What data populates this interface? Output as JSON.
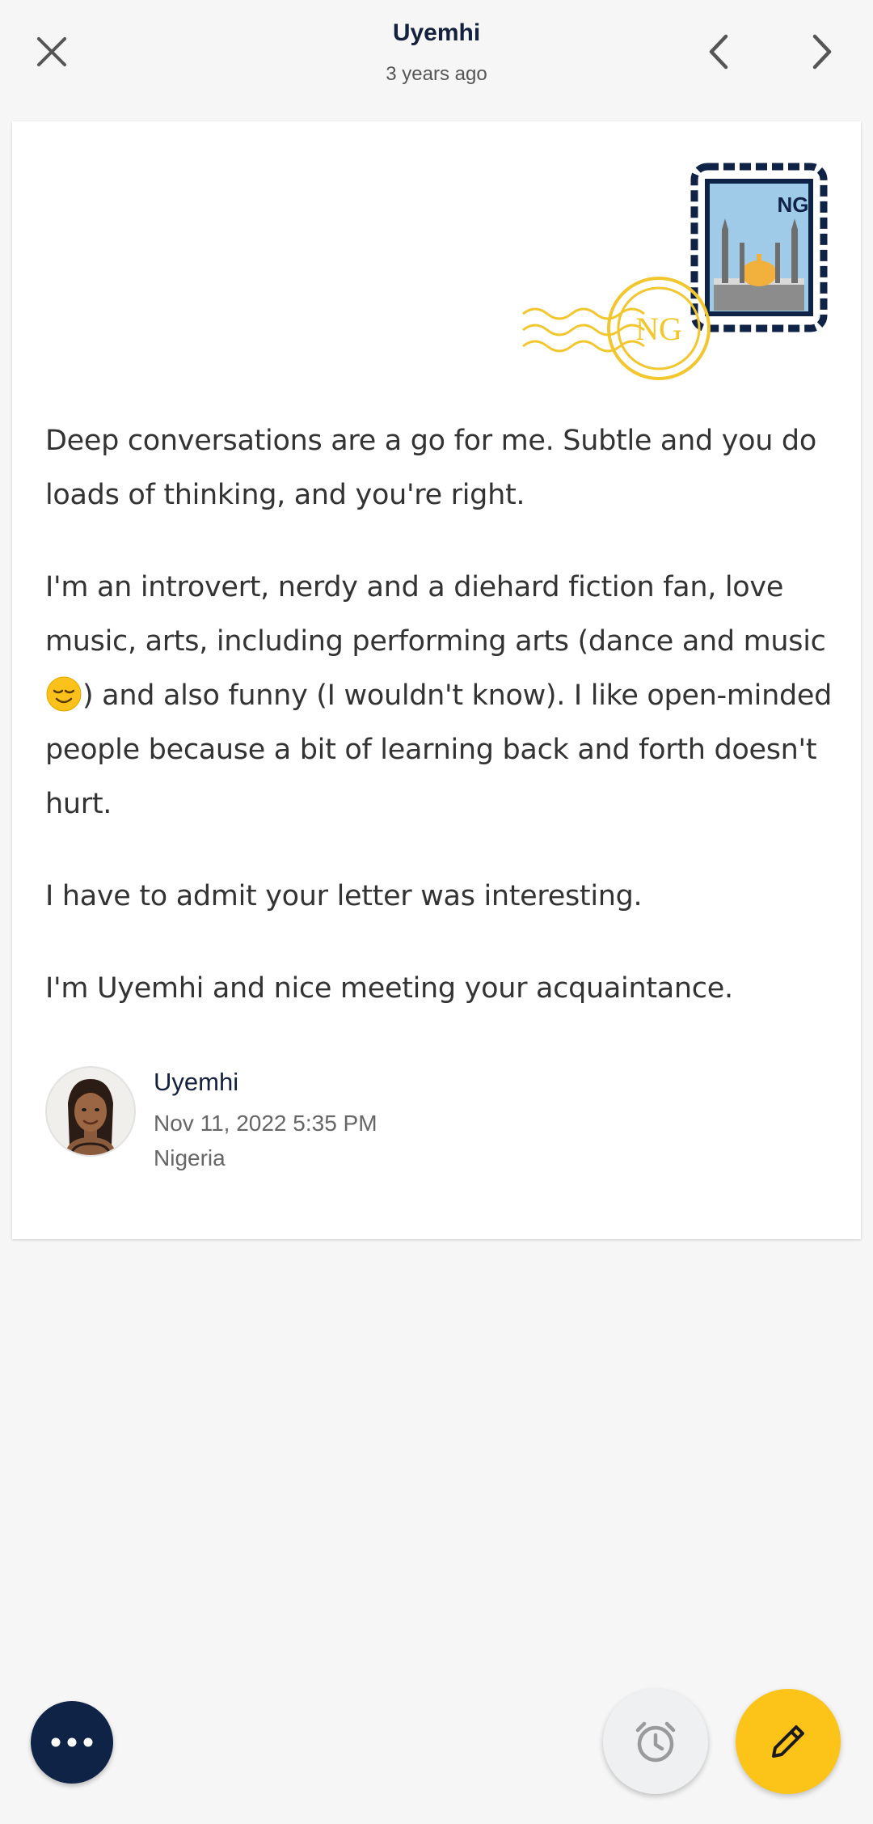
{
  "header": {
    "title": "Uyemhi",
    "subtitle": "3 years ago",
    "close_icon": "close-icon",
    "prev_icon": "chevron-left-icon",
    "next_icon": "chevron-right-icon"
  },
  "stamp": {
    "country_code": "NG",
    "postmark_text": "NG",
    "postmark_color": "#f2c62d",
    "frame_color": "#0f2347"
  },
  "letter": {
    "paragraphs": [
      {
        "text": "Deep conversations are a go for me. Subtle and you do loads of thinking, and you're right."
      },
      {
        "text_before_emoji": "I'm an introvert, nerdy and a diehard fiction fan, love music, arts, including performing arts (dance and music",
        "emoji": "relieved-face-emoji",
        "text_after_emoji": ") and also funny (I wouldn't know). I like open-minded people because a bit of learning back and forth doesn't hurt."
      },
      {
        "text": "I have to admit your letter was interesting."
      },
      {
        "text": "I'm Uyemhi and nice meeting your acquaintance."
      }
    ]
  },
  "signature": {
    "name": "Uyemhi",
    "date": "Nov 11, 2022 5:35 PM",
    "country": "Nigeria"
  },
  "actions": {
    "more_icon": "more-horizontal-icon",
    "snooze_icon": "alarm-clock-icon",
    "write_icon": "pencil-icon",
    "accent_color": "#fcc419",
    "dark_color": "#0f2347"
  }
}
